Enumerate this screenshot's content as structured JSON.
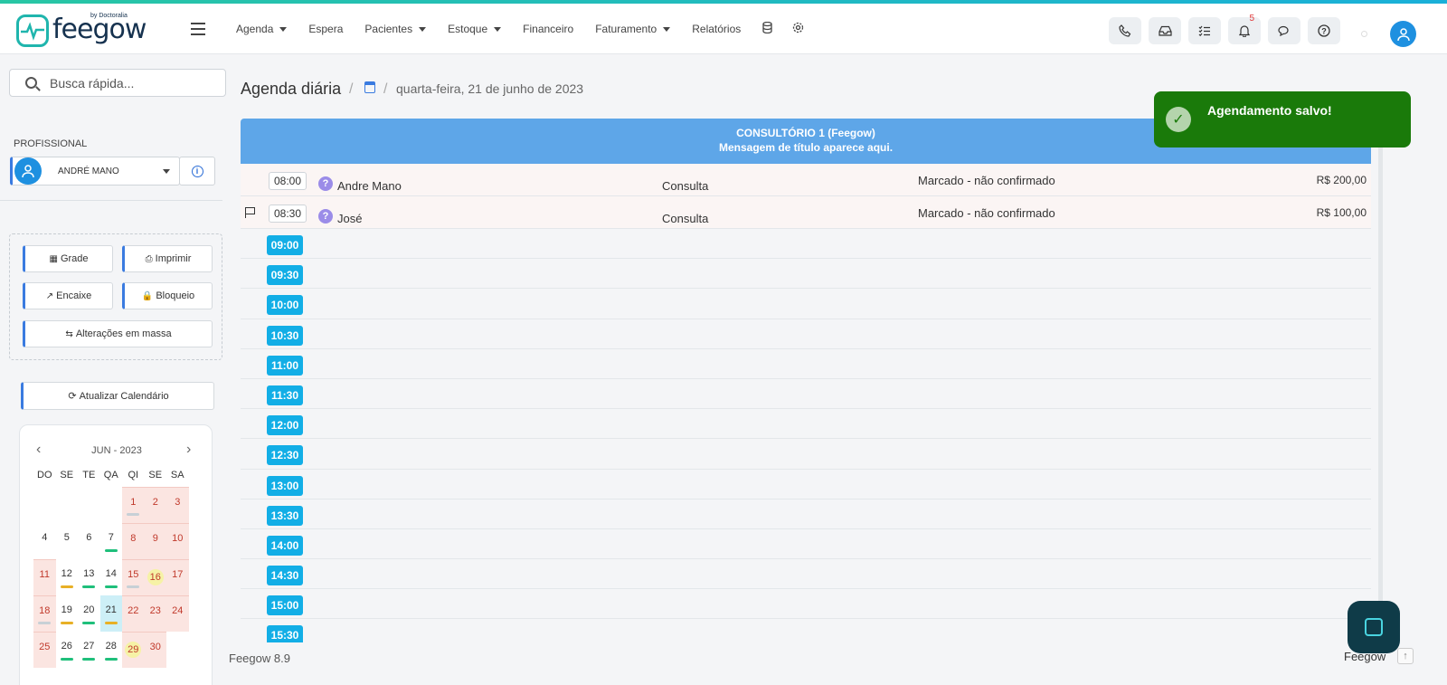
{
  "colors": {
    "accent": "#12aee6",
    "room_header": "#5ea6e8",
    "toast_bg": "#1a7a0a",
    "brand": "#1fb5ad"
  },
  "header": {
    "logo_text": "feegow",
    "logo_sub": "by Doctoralia",
    "nav": [
      {
        "label": "Agenda",
        "dropdown": true
      },
      {
        "label": "Espera",
        "dropdown": false
      },
      {
        "label": "Pacientes",
        "dropdown": true
      },
      {
        "label": "Estoque",
        "dropdown": true
      },
      {
        "label": "Financeiro",
        "dropdown": false
      },
      {
        "label": "Faturamento",
        "dropdown": true
      },
      {
        "label": "Relatórios",
        "dropdown": false
      }
    ],
    "nav_icons": [
      "database-icon",
      "gear-icon"
    ],
    "buttons": [
      "phone-icon",
      "inbox-icon",
      "checklist-icon",
      "bell-icon",
      "chat-icon",
      "help-icon"
    ],
    "notification_count": "5"
  },
  "sidebar": {
    "search_placeholder": "Busca rápida...",
    "professional_label": "PROFISSIONAL",
    "professional_name": "ANDRÉ MANO",
    "buttons": {
      "grade": "Grade",
      "print": "Imprimir",
      "encaixe": "Encaixe",
      "bloqueio": "Bloqueio",
      "mass": "Alterações em massa"
    },
    "refresh": "Atualizar Calendário"
  },
  "calendar": {
    "month": "JUN - 2023",
    "dow": [
      "DO",
      "SE",
      "TE",
      "QA",
      "QI",
      "SE",
      "SA"
    ],
    "weeks": [
      [
        "",
        "",
        "",
        "",
        "1",
        "2",
        "3"
      ],
      [
        "4",
        "5",
        "6",
        "7",
        "8",
        "9",
        "10"
      ],
      [
        "11",
        "12",
        "13",
        "14",
        "15",
        "16",
        "17"
      ],
      [
        "18",
        "19",
        "20",
        "21",
        "22",
        "23",
        "24"
      ],
      [
        "25",
        "26",
        "27",
        "28",
        "29",
        "30",
        ""
      ]
    ]
  },
  "main": {
    "title": "Agenda diária",
    "date": "quarta-feira, 21 de junho de 2023",
    "room_title": "CONSULTÓRIO 1 (Feegow)",
    "room_message": "Mensagem de título aparece aqui.",
    "appointments": [
      {
        "time": "08:00",
        "patient": "Andre Mano",
        "procedure": "Consulta",
        "status": "Marcado - não confirmado",
        "price": "R$ 200,00"
      },
      {
        "time": "08:30",
        "patient": "José",
        "procedure": "Consulta",
        "status": "Marcado - não confirmado",
        "price": "R$ 100,00"
      }
    ],
    "free_slots": [
      "09:00",
      "09:30",
      "10:00",
      "10:30",
      "11:00",
      "11:30",
      "12:00",
      "12:30",
      "13:00",
      "13:30",
      "14:00",
      "14:30",
      "15:00",
      "15:30"
    ]
  },
  "toast": {
    "message": "Agendamento salvo!"
  },
  "footer": {
    "version": "Feegow 8.9",
    "brand": "Feegow"
  }
}
